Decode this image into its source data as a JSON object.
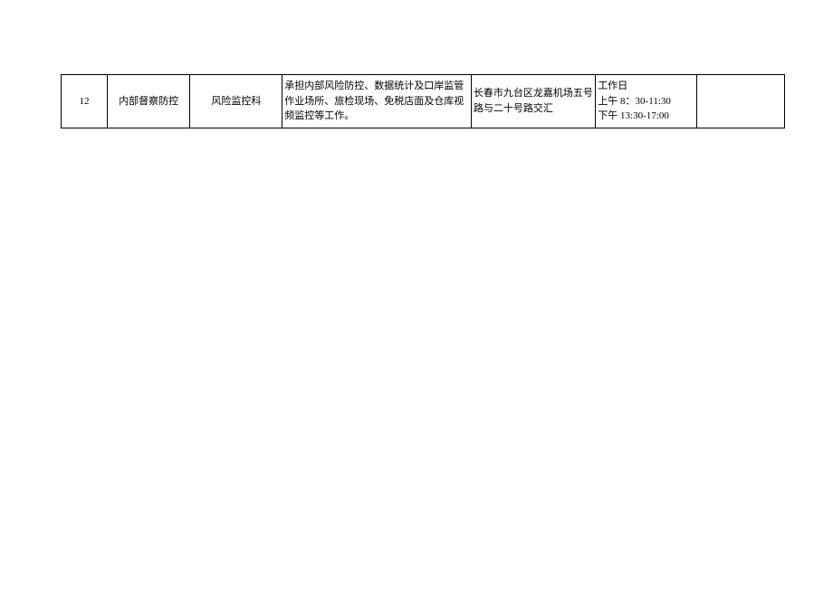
{
  "table": {
    "rows": [
      {
        "num": "12",
        "category": "内部督察防控",
        "department": "风险监控科",
        "duty": "承担内部风险防控、数据统计及口岸监管作业场所、旅检现场、免税店面及仓库视频监控等工作。",
        "address": "长春市九台区龙嘉机场五号路与二十号路交汇",
        "time": "工作日\n上午 8：30-11:30\n下午 13:30-17:00",
        "last": ""
      }
    ]
  }
}
